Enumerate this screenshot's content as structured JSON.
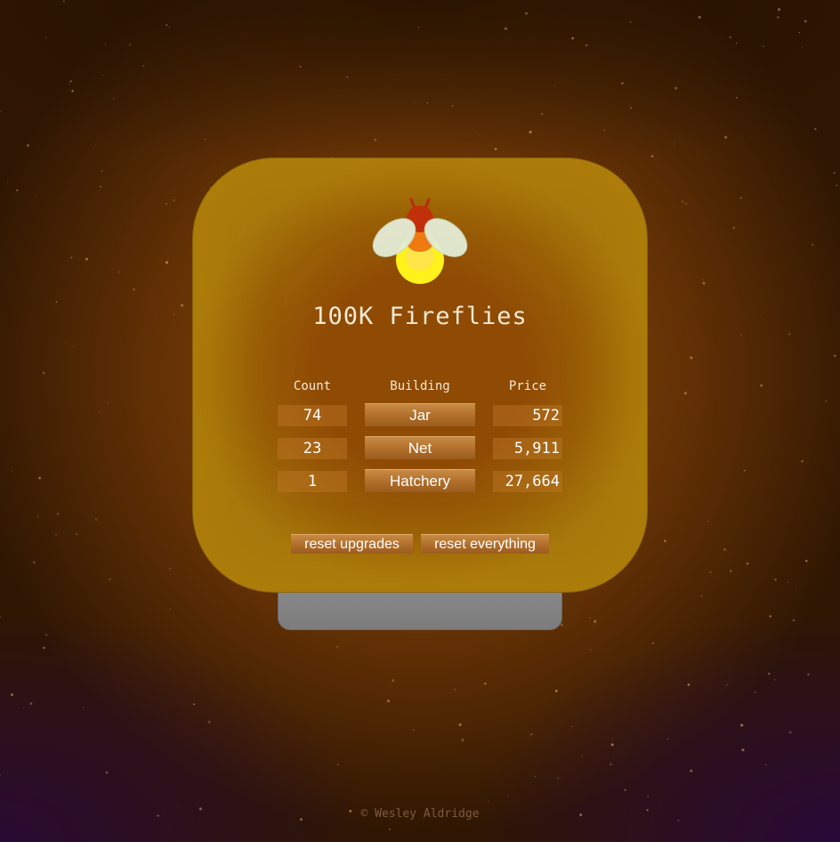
{
  "game": {
    "title": "100K Fireflies"
  },
  "table": {
    "headers": {
      "count": "Count",
      "building": "Building",
      "price": "Price"
    },
    "rows": [
      {
        "count": "74",
        "building": "Jar",
        "price": "572"
      },
      {
        "count": "23",
        "building": "Net",
        "price": "5,911"
      },
      {
        "count": "1",
        "building": "Hatchery",
        "price": "27,664"
      }
    ]
  },
  "actions": {
    "reset_upgrades": "reset upgrades",
    "reset_everything": "reset everything"
  },
  "footer": {
    "credit": "© Wesley Aldridge"
  },
  "icons": {
    "firefly": "firefly-icon"
  },
  "colors": {
    "jar_glow": "#a6780c",
    "button": "#b06e2a",
    "lid": "#8e8e8e"
  }
}
